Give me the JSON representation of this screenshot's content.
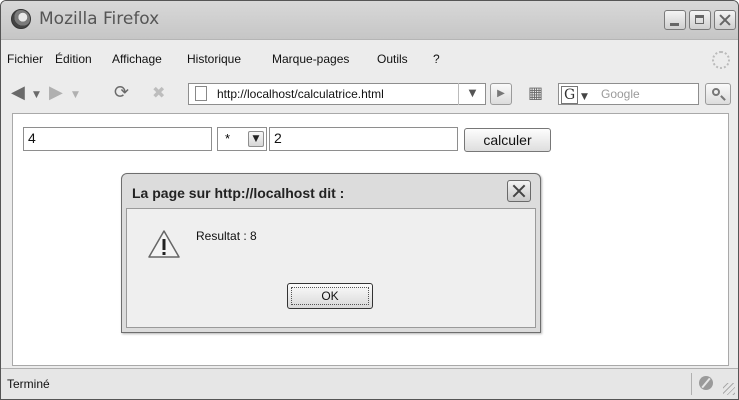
{
  "window": {
    "title": "Mozilla Firefox"
  },
  "menubar": {
    "items": [
      "Fichier",
      "Édition",
      "Affichage",
      "Historique",
      "Marque-pages",
      "Outils",
      "?"
    ]
  },
  "navbar": {
    "url": "http://localhost/calculatrice.html",
    "search_placeholder": "Google",
    "search_engine_letter": "G"
  },
  "form": {
    "operand1": "4",
    "operator": "*",
    "operand2": "2",
    "submit_label": "calculer"
  },
  "dialog": {
    "title": "La page sur http://localhost dit :",
    "message": "Resultat : 8",
    "ok_label": "OK"
  },
  "statusbar": {
    "text": "Terminé"
  }
}
